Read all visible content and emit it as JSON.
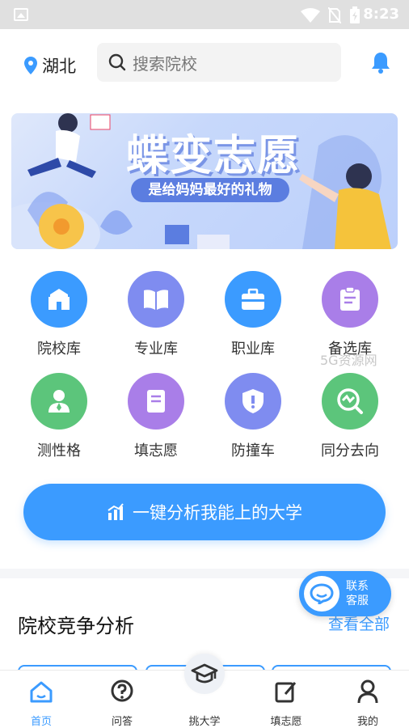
{
  "status_bar": {
    "time": "8:23"
  },
  "header": {
    "location": "湖北",
    "search_placeholder": "搜索院校"
  },
  "banner": {
    "title": "蝶变志愿",
    "subtitle": "是给妈妈最好的礼物"
  },
  "grid": {
    "items": [
      {
        "label": "院校库",
        "color": "#3b9bff"
      },
      {
        "label": "专业库",
        "color": "#7f8cf0"
      },
      {
        "label": "职业库",
        "color": "#3b9bff"
      },
      {
        "label": "备选库",
        "color": "#a97ee8"
      },
      {
        "label": "测性格",
        "color": "#5cc57b"
      },
      {
        "label": "填志愿",
        "color": "#a97ee8"
      },
      {
        "label": "防撞车",
        "color": "#7f8cf0"
      },
      {
        "label": "同分去向",
        "color": "#5cc57b"
      }
    ]
  },
  "cta": {
    "label": "一键分析我能上的大学"
  },
  "float_service": {
    "line1": "联系",
    "line2": "客服"
  },
  "section": {
    "title": "院校竞争分析",
    "more": "查看全部"
  },
  "tabs": [
    {
      "label": "首页",
      "icon": "home-icon",
      "active": true
    },
    {
      "label": "问答",
      "icon": "question-icon",
      "active": false
    },
    {
      "label": "挑大学",
      "icon": "graduation-cap-icon",
      "active": false
    },
    {
      "label": "填志愿",
      "icon": "edit-icon",
      "active": false
    },
    {
      "label": "我的",
      "icon": "user-icon",
      "active": false
    }
  ],
  "watermark": "5G资源网",
  "colors": {
    "accent": "#3b9bff"
  }
}
